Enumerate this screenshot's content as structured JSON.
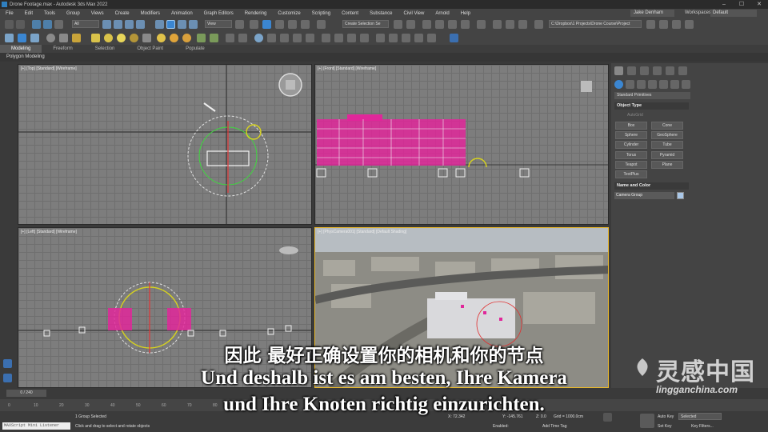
{
  "window": {
    "title": "Drone Footage.max - Autodesk 3ds Max 2022",
    "controls": [
      "–",
      "☐",
      "✕"
    ]
  },
  "menu": [
    "File",
    "Edit",
    "Tools",
    "Group",
    "Views",
    "Create",
    "Modifiers",
    "Animation",
    "Graph Editors",
    "Rendering",
    "Customize",
    "Scripting",
    "Content",
    "Substance",
    "Civil View",
    "Arnold",
    "Help"
  ],
  "user": "Jake Denham",
  "workspaces": {
    "label": "Workspaces:",
    "value": "Default"
  },
  "toolbar": {
    "filter": "All",
    "view": "View",
    "selection_set": "Create Selection Se",
    "path": "C:\\Dropbox\\1 Projects\\Drone Course\\Project"
  },
  "ribbon_tabs": [
    "Modeling",
    "Freeform",
    "Selection",
    "Object Paint",
    "Populate"
  ],
  "ribbon_label": "Polygon Modeling",
  "viewports": {
    "top": "[+] [Top] [Standard] [Wireframe]",
    "front": "[+] [Front] [Standard] [Wireframe]",
    "left": "[+] [Left] [Standard] [Wireframe]",
    "camera": "[+] [PhysCamera001] [Standard] [Default Shading]"
  },
  "command_panel": {
    "dropdown": "Standard Primitives",
    "object_type": "Object Type",
    "autogrid": "AutoGrid",
    "buttons": [
      "Box",
      "Cone",
      "Sphere",
      "GeoSphere",
      "Cylinder",
      "Tube",
      "Torus",
      "Pyramid",
      "Teapot",
      "Plane",
      "TextPlus"
    ],
    "name_color": "Name and Color",
    "name_value": "Camera Group"
  },
  "timeline": {
    "frame": "0 / 240",
    "ticks": [
      "0",
      "10",
      "20",
      "30",
      "40",
      "50",
      "60",
      "70",
      "80",
      "90",
      "100"
    ]
  },
  "status": {
    "maxscript": "MAXScript Mini Listener",
    "selected": "1 Group Selected",
    "prompt": "Click and drag to select and rotate objects",
    "x": "X: 72.342",
    "y": "Y: -145.761",
    "z": "Z: 0.0",
    "grid": "Grid = 1000.0cm",
    "enabled": "Enabled:",
    "add_time_tag": "Add Time Tag",
    "auto_key": "Auto Key",
    "set_key": "Set Key",
    "selected_dd": "Selected",
    "key_filters": "Key Filters..."
  },
  "subtitles": {
    "chinese": "因此 最好正确设置你的相机和你的节点",
    "german_line1": "Und deshalb ist es am besten, Ihre Kamera",
    "german_line2": "und Ihre Knoten richtig einzurichten."
  },
  "watermark": {
    "title": "灵感中国",
    "url": "lingganchina.com"
  },
  "colors": {
    "accent": "#e9b82b",
    "building": "#e0279a",
    "camera_target": "#d6d21e"
  }
}
